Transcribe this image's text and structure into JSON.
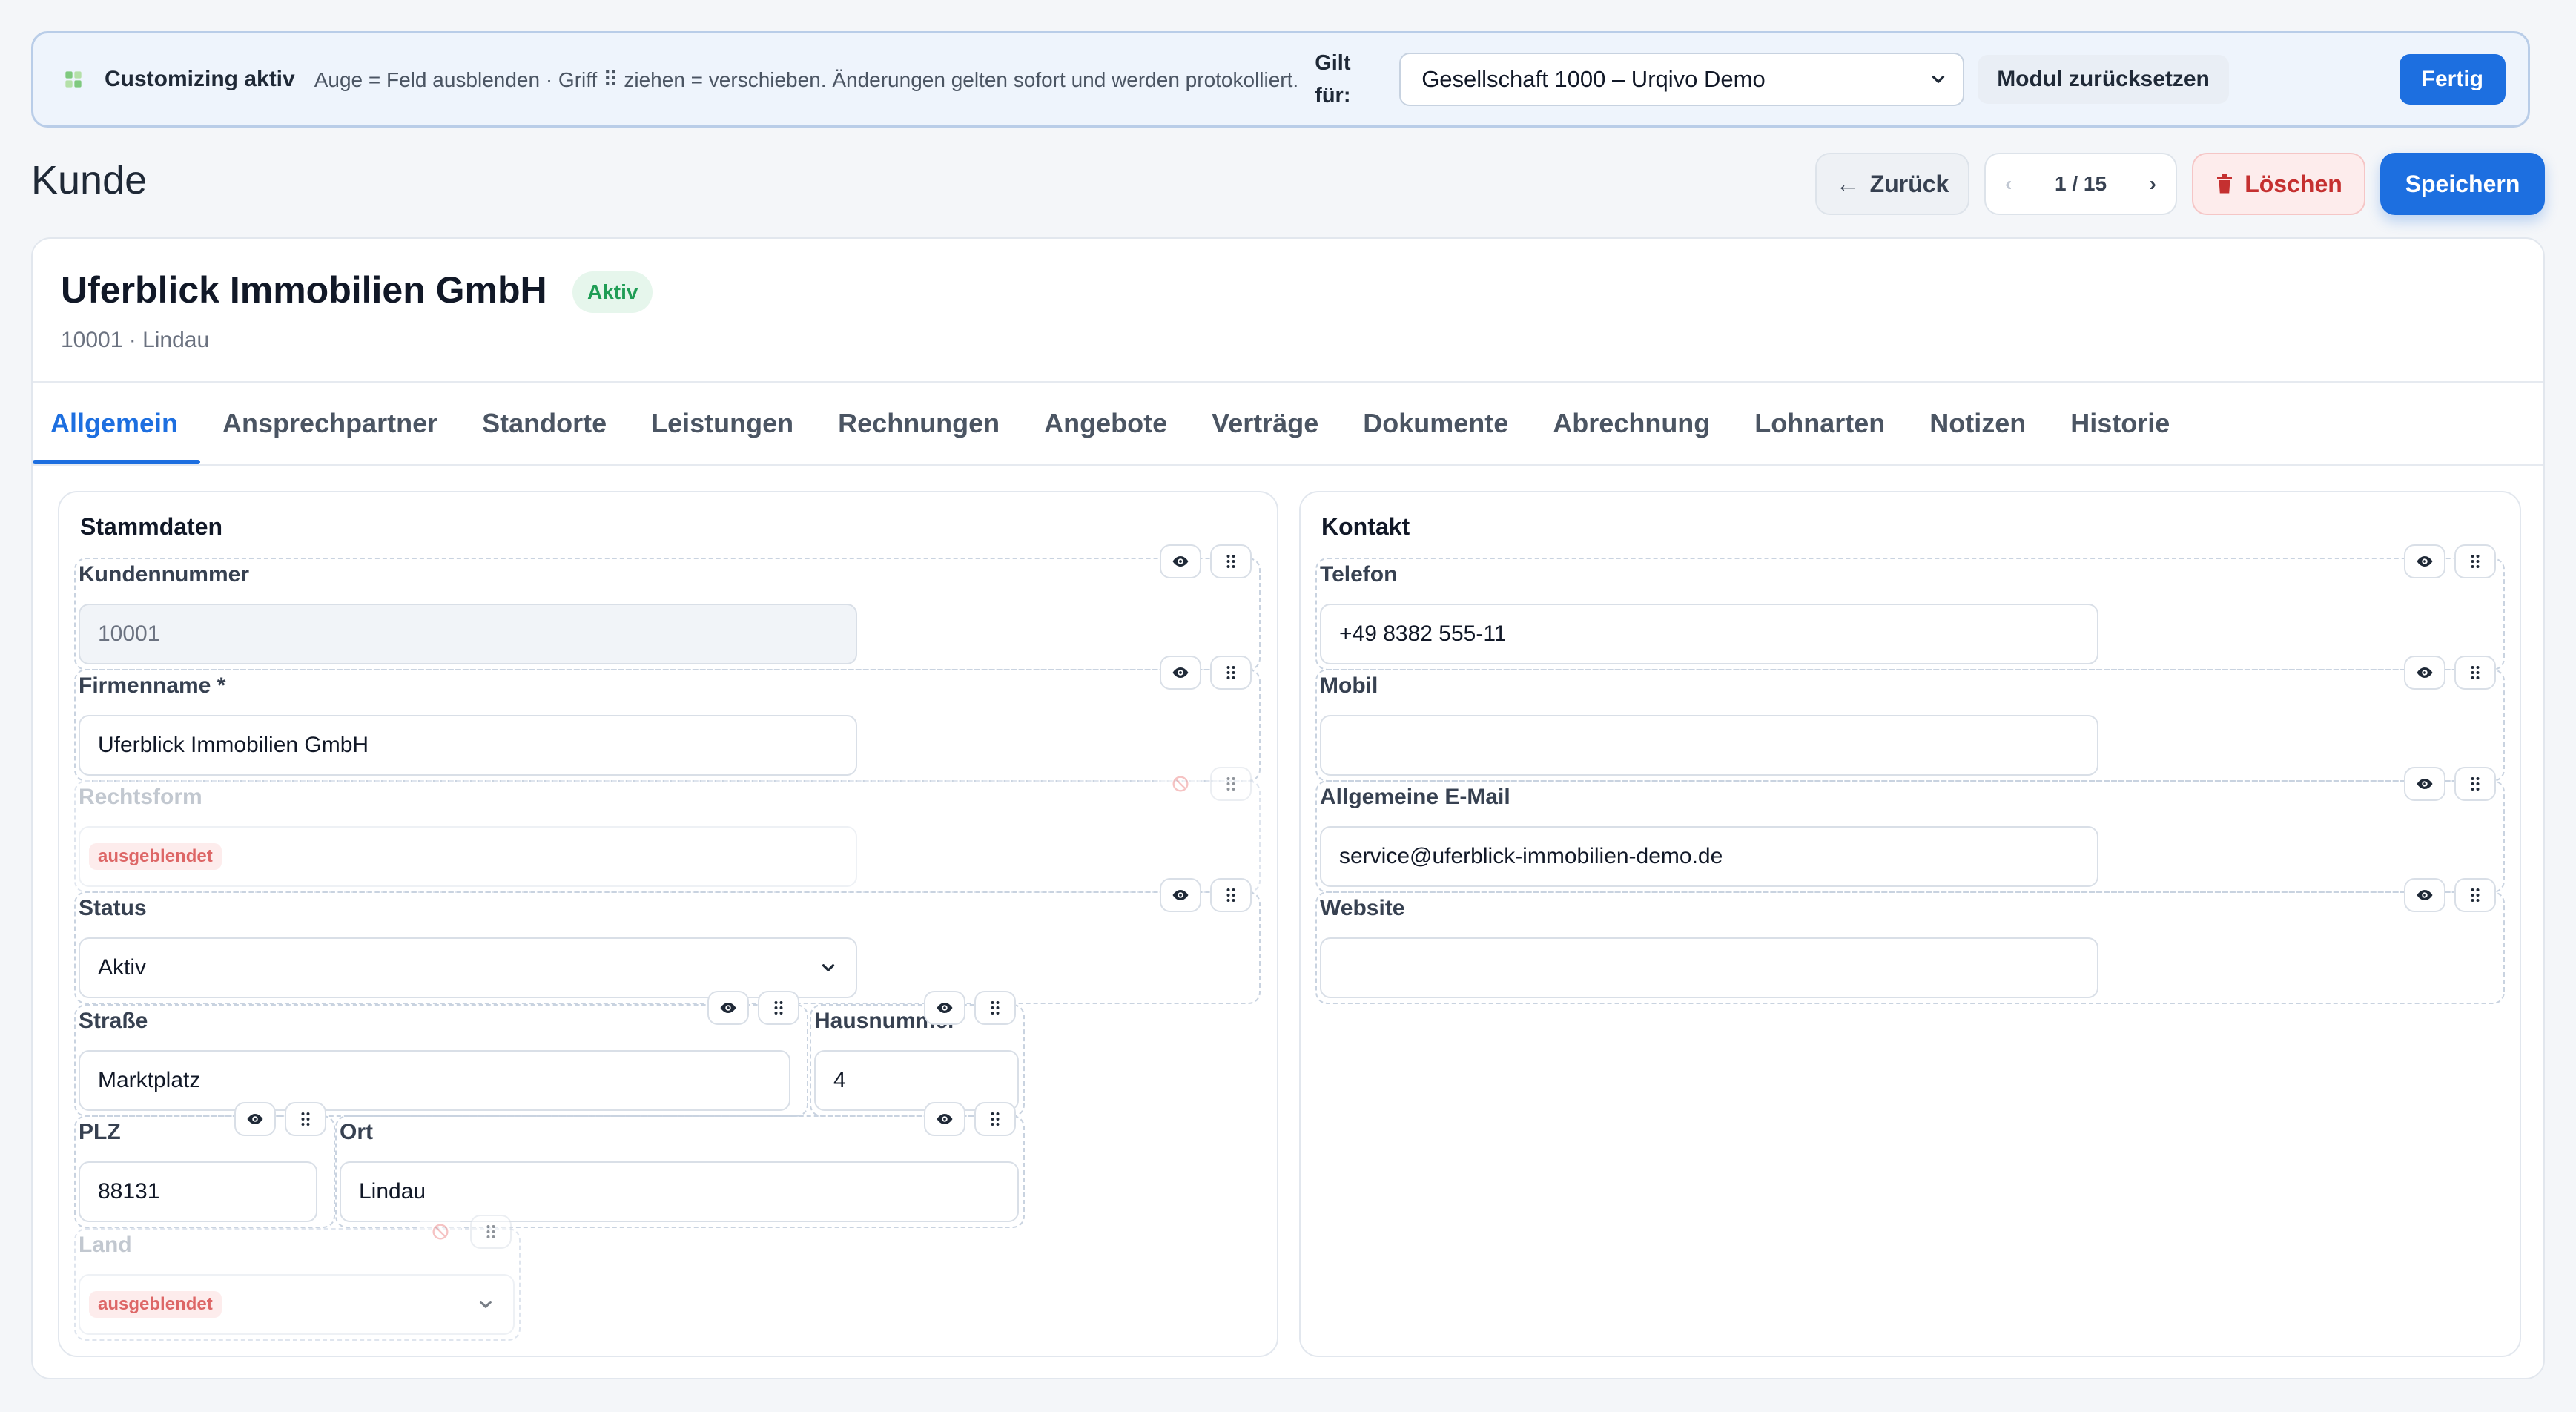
{
  "banner": {
    "title": "Customizing aktiv",
    "hint": "Auge = Feld ausblenden · Griff ⠿ ziehen = verschieben. Änderungen gelten sofort und werden protokolliert.",
    "gilt_label": "Gilt für:",
    "company_select": "Gesellschaft 1000 – Urqivo Demo",
    "reset_label": "Modul zurücksetzen",
    "done_label": "Fertig"
  },
  "page": {
    "title": "Kunde",
    "back_label": "Zurück",
    "pager": "1 / 15",
    "delete_label": "Löschen",
    "save_label": "Speichern"
  },
  "customer": {
    "name": "Uferblick Immobilien GmbH",
    "status": "Aktiv",
    "subtitle": "10001 · Lindau"
  },
  "tabs": [
    "Allgemein",
    "Ansprechpartner",
    "Standorte",
    "Leistungen",
    "Rechnungen",
    "Angebote",
    "Verträge",
    "Dokumente",
    "Abrechnung",
    "Lohnarten",
    "Notizen",
    "Historie"
  ],
  "stammdaten": {
    "title": "Stammdaten",
    "kundennummer": {
      "label": "Kundennummer",
      "value": "10001"
    },
    "firmenname": {
      "label": "Firmenname *",
      "value": "Uferblick Immobilien GmbH"
    },
    "rechtsform": {
      "label": "Rechtsform",
      "tag": "ausgeblendet"
    },
    "status": {
      "label": "Status",
      "value": "Aktiv"
    },
    "strasse": {
      "label": "Straße",
      "value": "Marktplatz"
    },
    "hausnummer": {
      "label": "Hausnummer",
      "value": "4"
    },
    "plz": {
      "label": "PLZ",
      "value": "88131"
    },
    "ort": {
      "label": "Ort",
      "value": "Lindau"
    },
    "land": {
      "label": "Land",
      "tag": "ausgeblendet"
    }
  },
  "kontakt": {
    "title": "Kontakt",
    "telefon": {
      "label": "Telefon",
      "value": "+49 8382 555-11"
    },
    "mobil": {
      "label": "Mobil",
      "value": ""
    },
    "email": {
      "label": "Allgemeine E-Mail",
      "value": "service@uferblick-immobilien-demo.de"
    },
    "website": {
      "label": "Website",
      "value": ""
    }
  },
  "colors": {
    "accent": "#1d6fe0",
    "danger": "#c53030",
    "success": "#1f9d55"
  },
  "icons": {
    "banner": "puzzle-icon",
    "show": "eye-icon",
    "hidden": "eye-off-icon",
    "drag": "drag-handle-icon",
    "back": "arrow-left-icon",
    "delete": "trash-icon"
  }
}
